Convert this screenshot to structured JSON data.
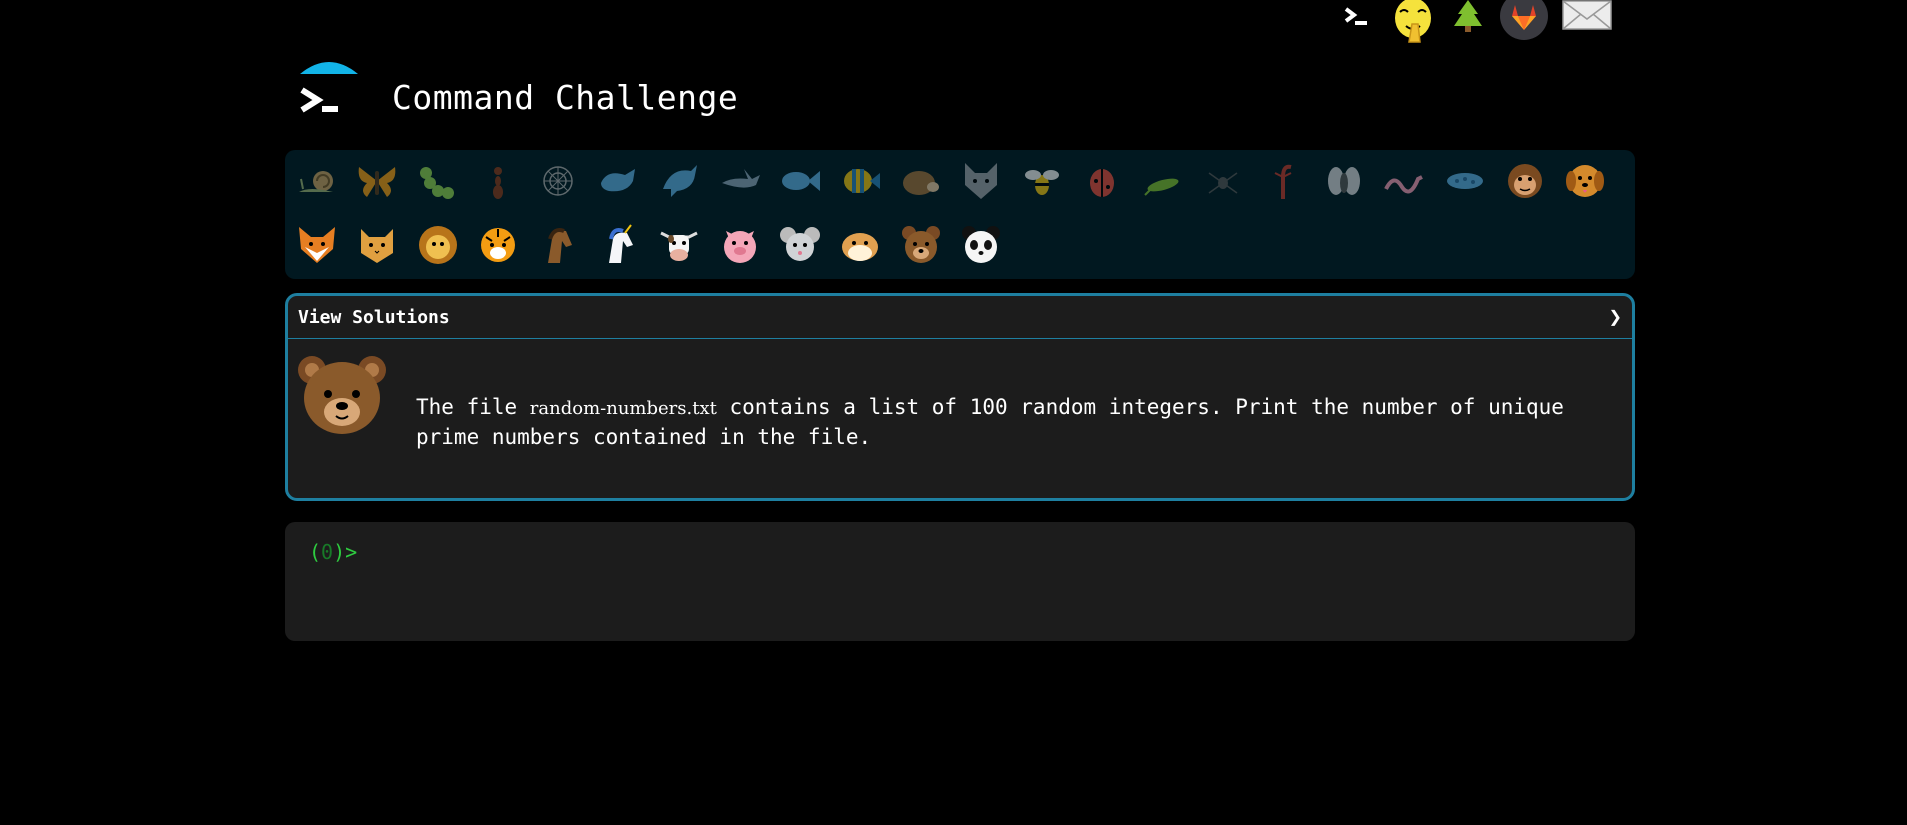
{
  "header": {
    "title": "Command Challenge"
  },
  "topnav": {
    "items": [
      "terminal-icon",
      "shushing-face-icon",
      "tree-icon",
      "gitlab-icon",
      "mail-icon"
    ]
  },
  "animals": {
    "row1": [
      "snail",
      "butterfly",
      "caterpillar",
      "ant",
      "spider-web",
      "whale",
      "dolphin",
      "shark",
      "fish",
      "tropical-fish",
      "hedgehog",
      "wolf",
      "bee",
      "ladybug",
      "cricket",
      "spider",
      "scorpion",
      "fly",
      "worm",
      "microbe",
      "monkey",
      "dog"
    ],
    "row2": [
      "fox",
      "cat",
      "lion",
      "tiger",
      "horse",
      "unicorn",
      "cow",
      "pig",
      "mouse",
      "hamster",
      "bear",
      "panda"
    ]
  },
  "panel": {
    "header_label": "View Solutions",
    "chevron": "❯",
    "desc_before": "The file ",
    "desc_filename": "random-numbers.txt",
    "desc_after": " contains a list of 100 random integers. Print the number of unique prime numbers contained in the file."
  },
  "terminal": {
    "prompt_open": "(",
    "prompt_count": "0",
    "prompt_close": ")>",
    "input_value": ""
  },
  "colors": {
    "accent": "#1e7fa0",
    "prompt": "#2ecc40",
    "logo_cap": "#12b4e8",
    "grid_bg": "#011820",
    "panel_bg": "#1c1c1c"
  }
}
